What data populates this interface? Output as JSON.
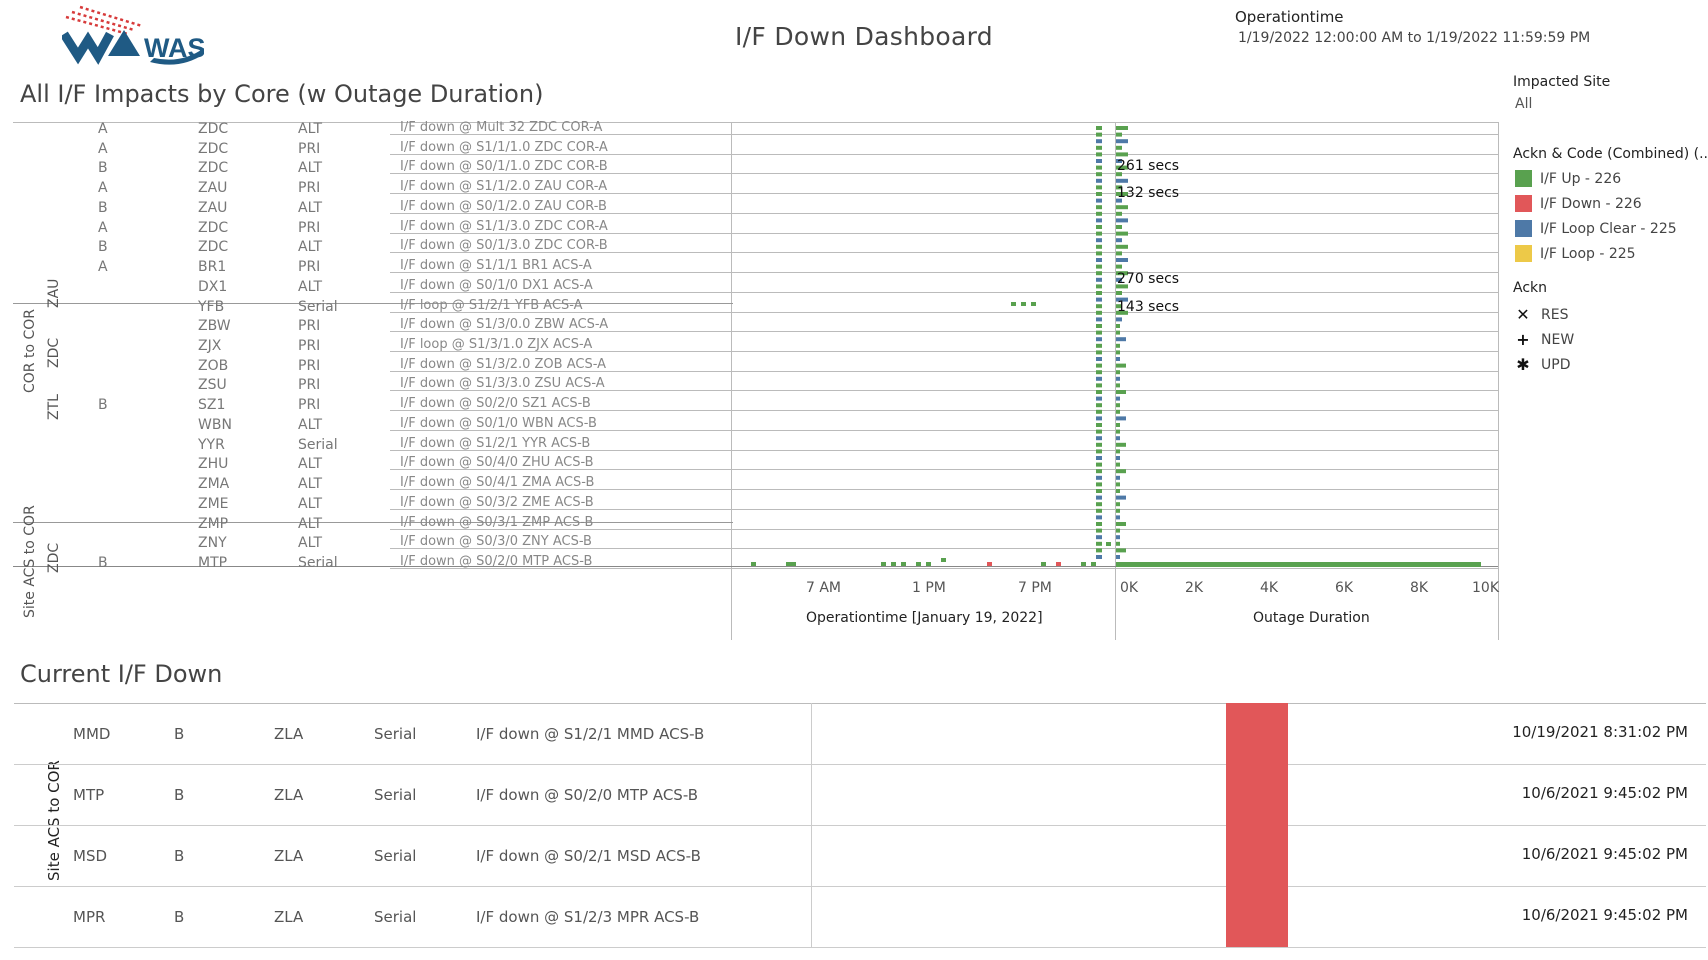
{
  "header": {
    "logo_text": "WAS",
    "title": "I/F Down Dashboard",
    "filter_label": "Operationtime",
    "filter_range": "1/19/2022 12:00:00 AM to 1/19/2022 11:59:59 PM"
  },
  "impacts": {
    "title": "All I/F Impacts by Core (w Outage Duration)",
    "groups": [
      "COR to COR",
      "Site ACS to COR"
    ],
    "cores": [
      "ZAU",
      "ZDC",
      "ZTL",
      "ZDC"
    ],
    "visible_rows": [
      {
        "col1": "A",
        "col2": "ZDC",
        "col3": "ALT",
        "col4": "I/F down @ Mult 32 ZDC COR-A"
      },
      {
        "col1": "A",
        "col2": "ZDC",
        "col3": "PRI",
        "col4": "I/F down @ S1/1/1.0 ZDC COR-A"
      },
      {
        "col1": "B",
        "col2": "ZDC",
        "col3": "ALT",
        "col4": "I/F down @ S0/1/1.0 ZDC COR-B"
      },
      {
        "col1": "A",
        "col2": "ZAU",
        "col3": "PRI",
        "col4": "I/F down @ S1/1/2.0 ZAU COR-A"
      },
      {
        "col1": "B",
        "col2": "ZAU",
        "col3": "ALT",
        "col4": "I/F down @ S0/1/2.0 ZAU COR-B"
      },
      {
        "col1": "A",
        "col2": "ZDC",
        "col3": "PRI",
        "col4": "I/F down @ S1/1/3.0 ZDC COR-A"
      },
      {
        "col1": "B",
        "col2": "ZDC",
        "col3": "ALT",
        "col4": "I/F down @ S0/1/3.0 ZDC COR-B"
      },
      {
        "col1": "A",
        "col2": "BR1",
        "col3": "PRI",
        "col4": "I/F down @ S1/1/1 BR1 ACS-A"
      },
      {
        "col1": "",
        "col2": "DX1",
        "col3": "ALT",
        "col4": "I/F down @ S0/1/0 DX1 ACS-A"
      },
      {
        "col1": "",
        "col2": "YFB",
        "col3": "Serial",
        "col4": "I/F loop @ S1/2/1 YFB ACS-A"
      },
      {
        "col1": "",
        "col2": "ZBW",
        "col3": "PRI",
        "col4": "I/F down @ S1/3/0.0 ZBW ACS-A"
      },
      {
        "col1": "",
        "col2": "ZJX",
        "col3": "PRI",
        "col4": "I/F loop @ S1/3/1.0 ZJX ACS-A"
      },
      {
        "col1": "",
        "col2": "ZOB",
        "col3": "PRI",
        "col4": "I/F down @ S1/3/2.0 ZOB ACS-A"
      },
      {
        "col1": "",
        "col2": "ZSU",
        "col3": "PRI",
        "col4": "I/F down @ S1/3/3.0 ZSU ACS-A"
      },
      {
        "col1": "B",
        "col2": "SZ1",
        "col3": "PRI",
        "col4": "I/F down @ S0/2/0 SZ1 ACS-B"
      },
      {
        "col1": "",
        "col2": "WBN",
        "col3": "ALT",
        "col4": "I/F down @ S0/1/0 WBN ACS-B"
      },
      {
        "col1": "",
        "col2": "YYR",
        "col3": "Serial",
        "col4": "I/F down @ S1/2/1 YYR ACS-B"
      },
      {
        "col1": "",
        "col2": "ZHU",
        "col3": "ALT",
        "col4": "I/F down @ S0/4/0 ZHU ACS-B"
      },
      {
        "col1": "",
        "col2": "ZMA",
        "col3": "ALT",
        "col4": "I/F down @ S0/4/1 ZMA ACS-B"
      },
      {
        "col1": "",
        "col2": "ZME",
        "col3": "ALT",
        "col4": "I/F down @ S0/3/2 ZME ACS-B"
      },
      {
        "col1": "",
        "col2": "ZMP",
        "col3": "ALT",
        "col4": "I/F down @ S0/3/1 ZMP ACS-B"
      },
      {
        "col1": "",
        "col2": "ZNY",
        "col3": "ALT",
        "col4": "I/F down @ S0/3/0 ZNY ACS-B"
      },
      {
        "col1": "B",
        "col2": "MTP",
        "col3": "Serial",
        "col4": "I/F down @ S0/2/0 MTP ACS-B"
      }
    ],
    "duration_labels": [
      "261 secs",
      "132 secs",
      "270 secs",
      "143 secs"
    ],
    "time_axis": {
      "ticks": [
        "7 AM",
        "1 PM",
        "7 PM"
      ],
      "title": "Operationtime [January 19, 2022]"
    },
    "duration_axis": {
      "ticks": [
        "0K",
        "2K",
        "4K",
        "6K",
        "8K",
        "10K"
      ],
      "title": "Outage Duration"
    }
  },
  "filters": {
    "impacted_site_label": "Impacted Site",
    "impacted_site_value": "All",
    "legend_title": "Ackn & Code (Combined) (..",
    "legend": [
      {
        "label": "I/F Up - 226",
        "color": "#59a14f"
      },
      {
        "label": "I/F Down - 226",
        "color": "#e15759"
      },
      {
        "label": "I/F Loop Clear - 225",
        "color": "#4e79a7"
      },
      {
        "label": "I/F Loop - 225",
        "color": "#edc948"
      }
    ],
    "ackn_title": "Ackn",
    "ackn": [
      {
        "symbol": "✕",
        "label": "RES"
      },
      {
        "symbol": "+",
        "label": "NEW"
      },
      {
        "symbol": "✱",
        "label": "UPD"
      }
    ]
  },
  "current": {
    "title": "Current I/F Down",
    "group_label": "Site ACS to COR",
    "rows": [
      {
        "site": "MMD",
        "side": "B",
        "core": "ZLA",
        "type": "Serial",
        "desc": "I/F down @ S1/2/1 MMD ACS-B",
        "time": "10/19/2021 8:31:02 PM"
      },
      {
        "site": "MTP",
        "side": "B",
        "core": "ZLA",
        "type": "Serial",
        "desc": "I/F down @ S0/2/0 MTP ACS-B",
        "time": "10/6/2021 9:45:02 PM"
      },
      {
        "site": "MSD",
        "side": "B",
        "core": "ZLA",
        "type": "Serial",
        "desc": "I/F down @ S0/2/1 MSD ACS-B",
        "time": "10/6/2021 9:45:02 PM"
      },
      {
        "site": "MPR",
        "side": "B",
        "core": "ZLA",
        "type": "Serial",
        "desc": "I/F down @ S1/2/3 MPR ACS-B",
        "time": "10/6/2021 9:45:02 PM"
      }
    ],
    "bar_color": "#e15759"
  }
}
